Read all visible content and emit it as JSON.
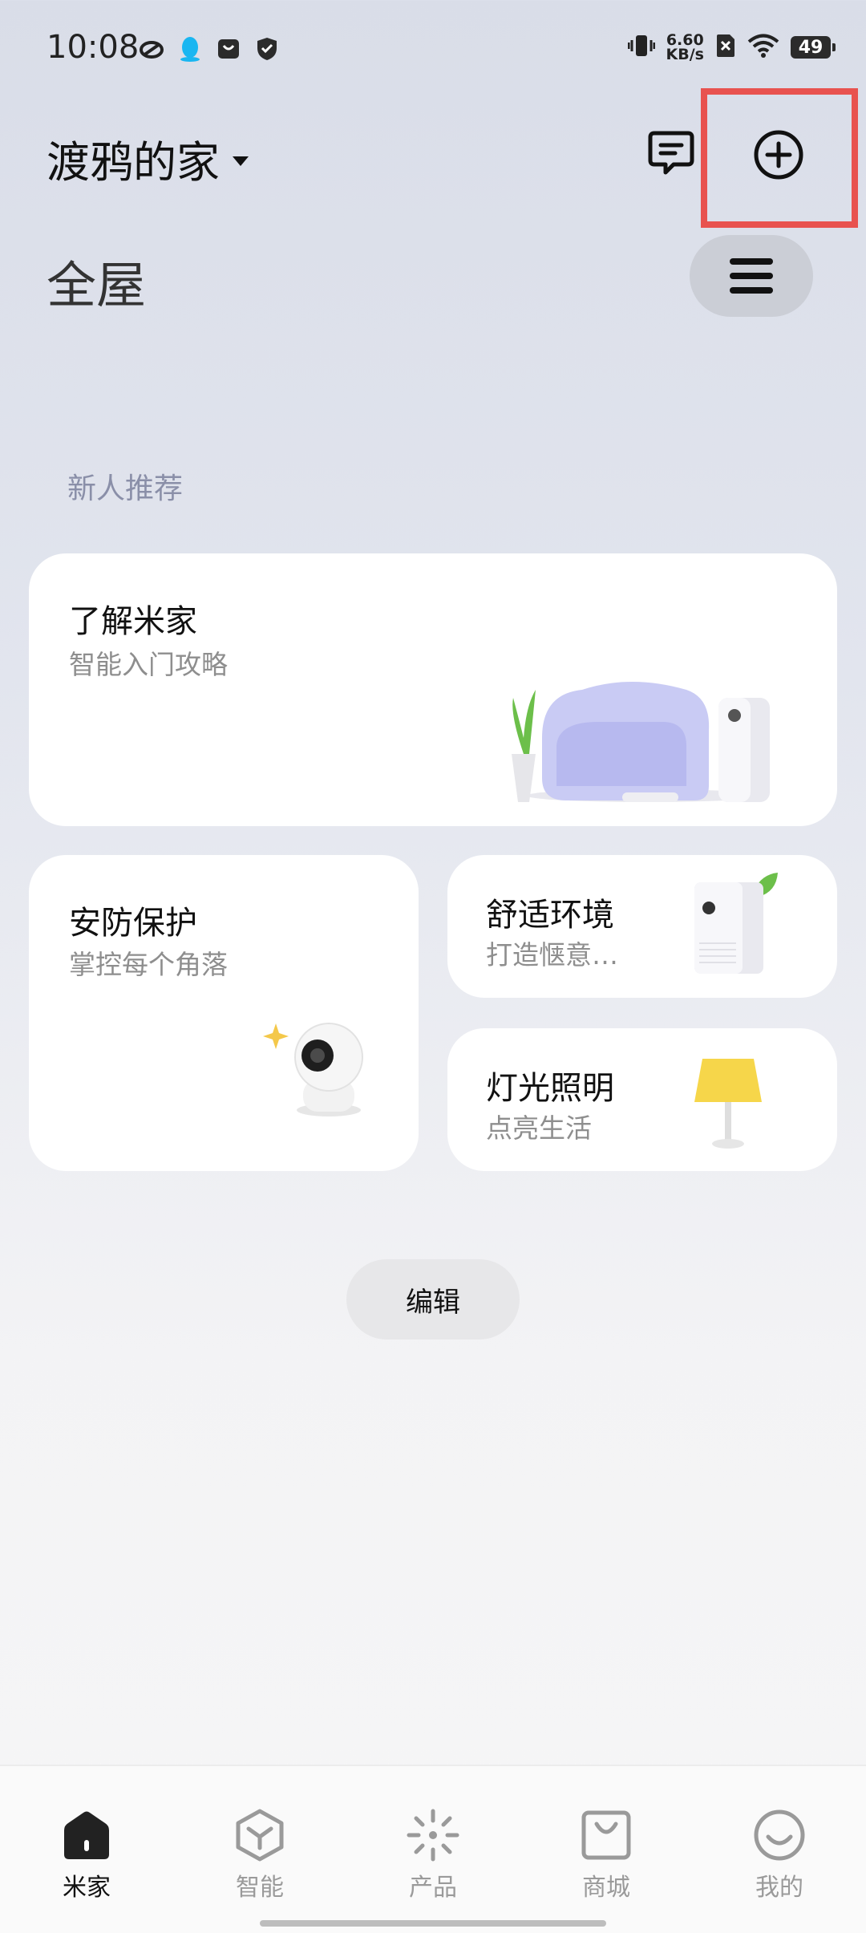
{
  "status_bar": {
    "time": "10:08",
    "net_speed_value": "6.60",
    "net_speed_unit": "KB/s",
    "battery": "49",
    "left_icons": [
      "weibo-icon",
      "qq-icon",
      "bag-icon",
      "shield-icon"
    ],
    "right_icons": [
      "vibrate-icon",
      "no-sim-icon",
      "wifi-icon",
      "battery-icon"
    ]
  },
  "header": {
    "home_name": "渡鸦的家",
    "room": "全屋"
  },
  "section": {
    "label": "新人推荐"
  },
  "cards": {
    "learn": {
      "title": "了解米家",
      "subtitle": "智能入门攻略"
    },
    "security": {
      "title": "安防保护",
      "subtitle": "掌控每个角落"
    },
    "comfort": {
      "title": "舒适环境",
      "subtitle": "打造惬意…"
    },
    "lighting": {
      "title": "灯光照明",
      "subtitle": "点亮生活"
    }
  },
  "edit_button": "编辑",
  "nav": [
    {
      "label": "米家",
      "icon": "home-icon",
      "active": true
    },
    {
      "label": "智能",
      "icon": "smart-cube-icon",
      "active": false
    },
    {
      "label": "产品",
      "icon": "product-spark-icon",
      "active": false
    },
    {
      "label": "商城",
      "icon": "shop-bag-icon",
      "active": false
    },
    {
      "label": "我的",
      "icon": "smiley-icon",
      "active": false
    }
  ],
  "colors": {
    "highlight": "#e8524f",
    "lamp_yellow": "#f6d64a",
    "sofa": "#c9cbf4",
    "leaf": "#6cbf4a"
  }
}
